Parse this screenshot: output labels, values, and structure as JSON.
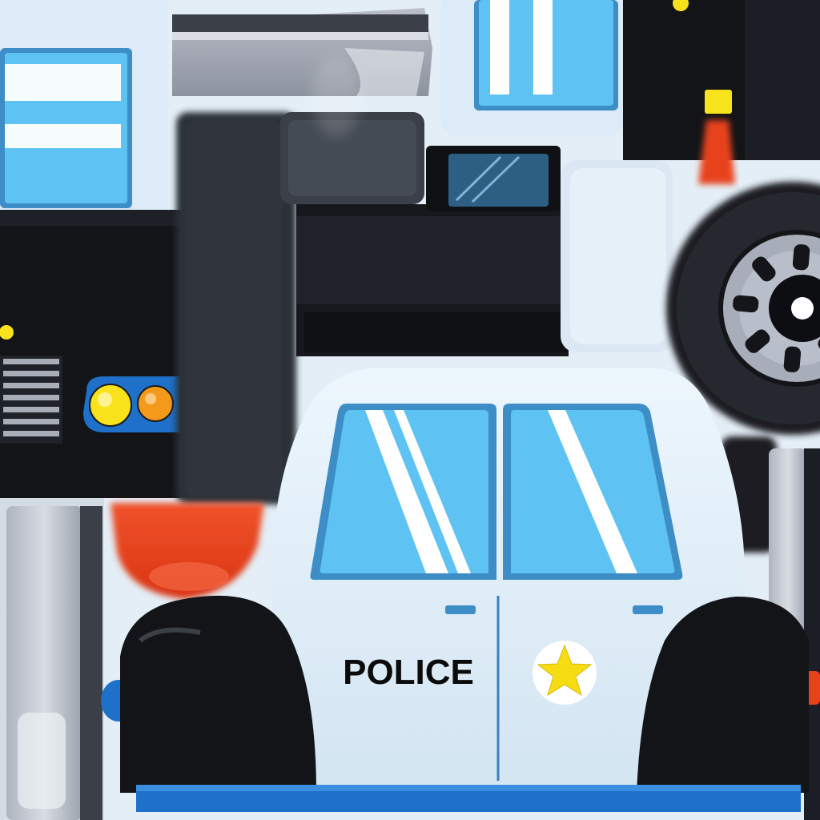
{
  "texture": {
    "kind": "police car texture atlas",
    "colors": {
      "body_white": "#e2f0fb",
      "body_shade": "#c9dcea",
      "window_blue": "#5ec3f3",
      "window_light": "#9ddcfa",
      "window_frame": "#3d8dc6",
      "black": "#121418",
      "charcoal": "#2c3038",
      "siren_red": "#e8421b",
      "light_blue": "#1e70c8",
      "headlight_yellow": "#f7e21c",
      "headlight_orange": "#f39a1a",
      "star_yellow": "#f6dc12",
      "wheel_gray": "#a7adb9"
    }
  },
  "panels": {
    "side_door": {
      "label": "POLICE",
      "emblem_icon": "star-icon",
      "windows": 2,
      "handles": 2
    },
    "front_grille": {
      "headlights": [
        "yellow",
        "orange"
      ],
      "grille_slats": 7
    },
    "wheel": {
      "icon": "wheel-icon",
      "lug_slots": 8
    }
  }
}
